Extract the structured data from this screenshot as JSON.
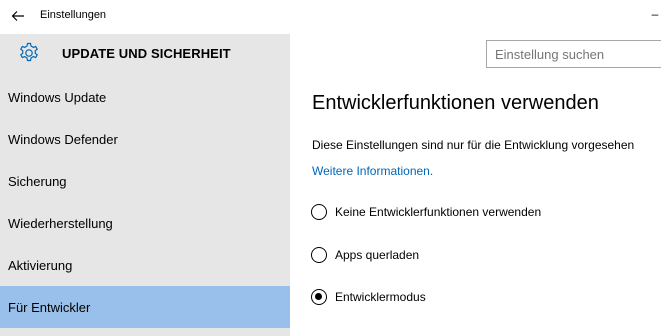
{
  "window": {
    "title": "Einstellungen",
    "back_icon": "back-arrow-icon",
    "minimize_glyph": "–"
  },
  "header": {
    "icon": "gear-icon",
    "title": "UPDATE UND SICHERHEIT"
  },
  "search": {
    "placeholder": "Einstellung suchen"
  },
  "sidebar": {
    "items": [
      {
        "label": "Windows Update",
        "selected": false
      },
      {
        "label": "Windows Defender",
        "selected": false
      },
      {
        "label": "Sicherung",
        "selected": false
      },
      {
        "label": "Wiederherstellung",
        "selected": false
      },
      {
        "label": "Aktivierung",
        "selected": false
      },
      {
        "label": "Für Entwickler",
        "selected": true
      }
    ]
  },
  "main": {
    "title": "Entwicklerfunktionen verwenden",
    "description": "Diese Einstellungen sind nur für die Entwicklung vorgesehen",
    "link": "Weitere Informationen.",
    "options": [
      {
        "label": "Keine Entwicklerfunktionen verwenden",
        "checked": false
      },
      {
        "label": "Apps querladen",
        "checked": false
      },
      {
        "label": "Entwicklermodus",
        "checked": true
      }
    ]
  },
  "colors": {
    "selected_item": "#99c0ea",
    "sidebar_bg": "#e6e6e6",
    "link": "#0067b8"
  }
}
